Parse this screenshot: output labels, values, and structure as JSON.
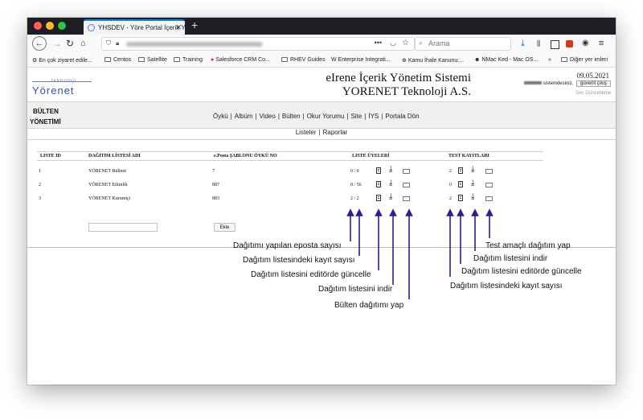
{
  "browser": {
    "tab_title": "YHSDEV - Yöre Portal İçerik Yö",
    "search_placeholder": "Arama",
    "bookmarks": [
      "En çok ziyaret edile...",
      "Centos",
      "Satellite",
      "Training",
      "Salesforce CRM Co...",
      "RHEV Guides",
      "Enterprise Integrati...",
      "Kamu İhale Kanunu:...",
      "NMac Ked - Mac OS...",
      "Diğer yer imleri"
    ]
  },
  "header": {
    "logo_small": "teknoloji",
    "logo_main": "Yörenet",
    "title_line1": "eIrene İçerik Yönetim Sistemi",
    "title_line2": "YORENET Teknoloji A.S.",
    "date": "09.05.2021",
    "user_suffix": "sistemdesiniz.",
    "logout_label": "güvenli çıkış",
    "last_update": "Son Güncelleme:"
  },
  "section": {
    "title_line1": "BÜLTEN",
    "title_line2": "YÖNETİMİ"
  },
  "main_menu": [
    "Öykü",
    "Albüm",
    "Video",
    "Bülten",
    "Okur Yorumu",
    "Site",
    "İYS",
    "Portala Dön"
  ],
  "sub_menu": [
    "Listeler",
    "Raporlar"
  ],
  "table": {
    "headers": {
      "liste_id": "LISTE ID",
      "adi": "DAĞITIM LİSTESİ ADI",
      "sablon": "e.Posta ŞABLONU ÖYKÜ NO",
      "uyeler": "LISTE ÜYELERİ",
      "test": "TEST KAYITLARI"
    },
    "rows": [
      {
        "id": "1",
        "name": "YÖRENET Bülteni",
        "template": "7",
        "members": "0 / 0",
        "test": "2"
      },
      {
        "id": "2",
        "name": "YÖRENET Etkinlik",
        "template": "887",
        "members": "0 / 56",
        "test": "0"
      },
      {
        "id": "3",
        "name": "YÖRENET Kurumiçi",
        "template": "883",
        "members": "2 / 2",
        "test": "2"
      }
    ],
    "add_button": "Ekle"
  },
  "annotations": {
    "left": [
      "Dağıtımı yapılan eposta sayısı",
      "Dağıtım listesindeki kayıt sayısı",
      "Dağıtım listesini editörde güncelle",
      "Dağıtım listesini indir",
      "Bülten dağıtımı yap"
    ],
    "right": [
      "Test amaçlı dağıtım yap",
      "Dağıtım listesini indir",
      "Dağıtım listesini editörde güncelle",
      "Dağıtım listesindeki kayıt sayısı"
    ],
    "arrow_color": "#2a1f8f"
  }
}
